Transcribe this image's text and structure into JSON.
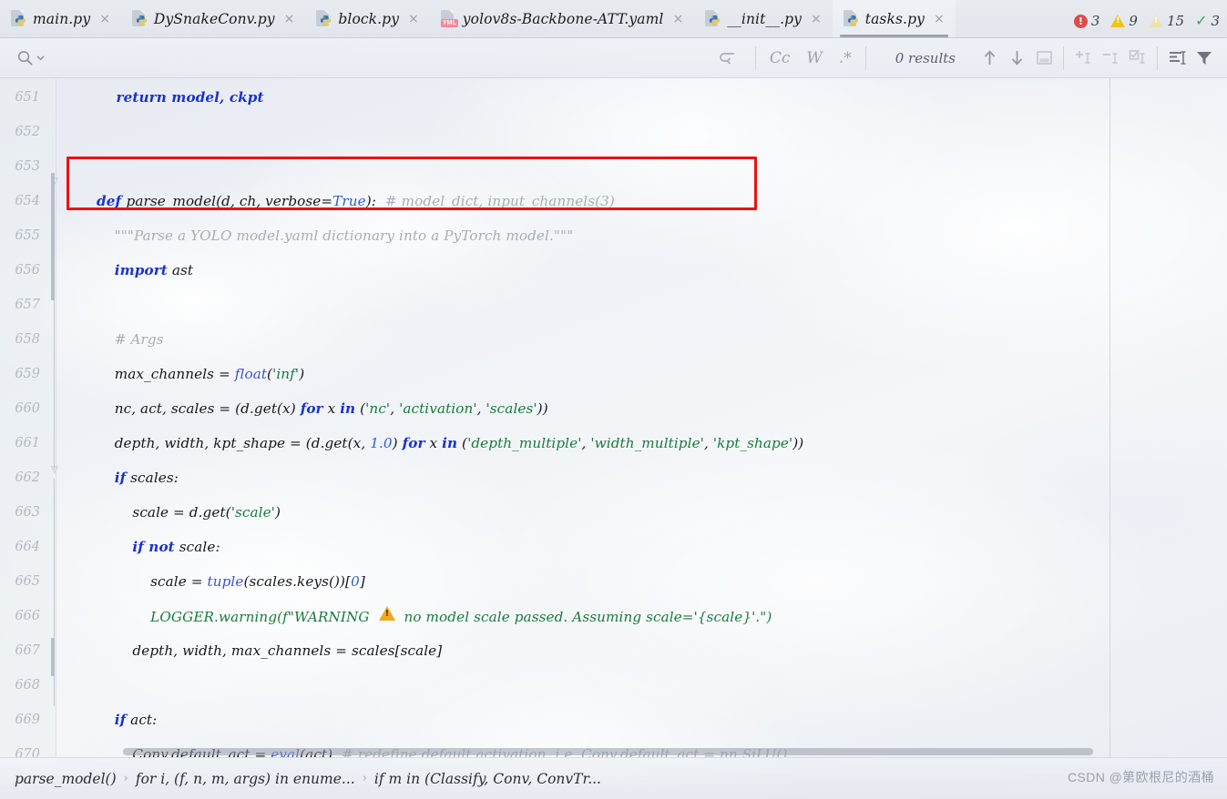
{
  "tabs": [
    {
      "label": "main.py",
      "icon": "python-file-icon",
      "active": false
    },
    {
      "label": "DySnakeConv.py",
      "icon": "python-file-icon",
      "active": false
    },
    {
      "label": "block.py",
      "icon": "python-file-icon",
      "active": false
    },
    {
      "label": "yolov8s-Backbone-ATT.yaml",
      "icon": "yaml-file-icon",
      "active": false
    },
    {
      "label": "__init__.py",
      "icon": "python-file-icon",
      "active": false
    },
    {
      "label": "tasks.py",
      "icon": "python-file-icon",
      "active": true
    }
  ],
  "findbar": {
    "search_value": "",
    "search_placeholder": "",
    "search_icon": "search-icon",
    "dropdown_icon": "chevron-down-icon",
    "multiline_icon": "multiline-toggle-icon",
    "match_case_label": "Cc",
    "words_label": "W",
    "regex_label": ".*",
    "results_label": "0 results",
    "prev_icon": "arrow-up-icon",
    "next_icon": "arrow-down-icon",
    "select_all_icon": "select-all-icon",
    "add_occurrence_icon": "add-occurrence-icon",
    "remove_occurrence_icon": "remove-occurrence-icon",
    "toggle_occurrence_icon": "toggle-occurrence-icon",
    "in_selection_icon": "search-in-selection-icon",
    "filter_icon": "filter-funnel-icon"
  },
  "inspections": {
    "error_count": "3",
    "warning_count": "9",
    "weak_warning_count": "15",
    "ok_count": "3",
    "error_color": "#e04a4a",
    "warning_color": "#f2c317",
    "weak_warning_color": "#eee2b4",
    "ok_color": "#37a846"
  },
  "editor": {
    "annotation_color": "#ee1111",
    "lines": [
      {
        "no": "651",
        "code": [
          {
            "t": "    return model, ckpt",
            "c": "kw-return"
          }
        ]
      },
      {
        "no": "652",
        "code": []
      },
      {
        "no": "653",
        "code": []
      },
      {
        "no": "654",
        "code": [
          {
            "t": "def ",
            "c": "kw"
          },
          {
            "t": "parse_model",
            "c": "fn"
          },
          {
            "t": "(d, ch, verbose=",
            "c": ""
          },
          {
            "t": "True",
            "c": "cnst"
          },
          {
            "t": "):  ",
            "c": ""
          },
          {
            "t": "# model_dict, input_channels(3)",
            "c": "cmt"
          }
        ]
      },
      {
        "no": "655",
        "code": [
          {
            "t": "    \"\"\"Parse a YOLO model.yaml dictionary into a PyTorch model.\"\"\"",
            "c": "doc"
          }
        ]
      },
      {
        "no": "656",
        "code": [
          {
            "t": "    ",
            "c": ""
          },
          {
            "t": "import",
            "c": "kw"
          },
          {
            "t": " ast",
            "c": ""
          }
        ]
      },
      {
        "no": "657",
        "code": []
      },
      {
        "no": "658",
        "code": [
          {
            "t": "    # Args",
            "c": "cmt"
          }
        ]
      },
      {
        "no": "659",
        "code": [
          {
            "t": "    max_channels = ",
            "c": ""
          },
          {
            "t": "float",
            "c": "bi"
          },
          {
            "t": "(",
            "c": ""
          },
          {
            "t": "'inf'",
            "c": "str"
          },
          {
            "t": ")",
            "c": ""
          }
        ]
      },
      {
        "no": "660",
        "code": [
          {
            "t": "    nc, act, scales = (d.get(x) ",
            "c": ""
          },
          {
            "t": "for",
            "c": "kw"
          },
          {
            "t": " x ",
            "c": ""
          },
          {
            "t": "in",
            "c": "kw"
          },
          {
            "t": " (",
            "c": ""
          },
          {
            "t": "'nc'",
            "c": "str"
          },
          {
            "t": ", ",
            "c": ""
          },
          {
            "t": "'activation'",
            "c": "str"
          },
          {
            "t": ", ",
            "c": ""
          },
          {
            "t": "'scales'",
            "c": "str"
          },
          {
            "t": "))",
            "c": ""
          }
        ]
      },
      {
        "no": "661",
        "code": [
          {
            "t": "    depth, width, kpt_shape = (d.get(x, ",
            "c": ""
          },
          {
            "t": "1.0",
            "c": "num"
          },
          {
            "t": ") ",
            "c": ""
          },
          {
            "t": "for",
            "c": "kw"
          },
          {
            "t": " x ",
            "c": ""
          },
          {
            "t": "in",
            "c": "kw"
          },
          {
            "t": " (",
            "c": ""
          },
          {
            "t": "'depth_multiple'",
            "c": "str"
          },
          {
            "t": ", ",
            "c": ""
          },
          {
            "t": "'width_multiple'",
            "c": "str"
          },
          {
            "t": ", ",
            "c": ""
          },
          {
            "t": "'kpt_shape'",
            "c": "str"
          },
          {
            "t": "))",
            "c": ""
          }
        ]
      },
      {
        "no": "662",
        "code": [
          {
            "t": "    ",
            "c": ""
          },
          {
            "t": "if",
            "c": "kw"
          },
          {
            "t": " scales:",
            "c": ""
          }
        ]
      },
      {
        "no": "663",
        "code": [
          {
            "t": "        scale = d.get(",
            "c": ""
          },
          {
            "t": "'scale'",
            "c": "str"
          },
          {
            "t": ")",
            "c": ""
          }
        ]
      },
      {
        "no": "664",
        "code": [
          {
            "t": "        ",
            "c": ""
          },
          {
            "t": "if not",
            "c": "kw"
          },
          {
            "t": " scale:",
            "c": ""
          }
        ]
      },
      {
        "no": "665",
        "code": [
          {
            "t": "            scale = ",
            "c": ""
          },
          {
            "t": "tuple",
            "c": "bi"
          },
          {
            "t": "(scales.keys())[",
            "c": ""
          },
          {
            "t": "0",
            "c": "num"
          },
          {
            "t": "]",
            "c": ""
          }
        ]
      },
      {
        "no": "666",
        "code": [
          {
            "t": "            LOGGER.warning(",
            "c": "str"
          },
          {
            "t": "f\"WARNING ",
            "c": "str"
          },
          {
            "t": "WARN_EMOJI",
            "c": "emoji"
          },
          {
            "t": " no model scale passed. Assuming scale='{scale}'.\")",
            "c": "str"
          }
        ]
      },
      {
        "no": "667",
        "code": [
          {
            "t": "        depth, width, max_channels = scales[scale]",
            "c": ""
          }
        ]
      },
      {
        "no": "668",
        "code": []
      },
      {
        "no": "669",
        "code": [
          {
            "t": "    ",
            "c": ""
          },
          {
            "t": "if",
            "c": "kw"
          },
          {
            "t": " act:",
            "c": ""
          }
        ]
      },
      {
        "no": "670",
        "code": [
          {
            "t": "        Conv.default_act = ",
            "c": ""
          },
          {
            "t": "eval",
            "c": "bi"
          },
          {
            "t": "(act)  ",
            "c": ""
          },
          {
            "t": "# redefine default activation, i.e. Conv.default_act = nn.SiLU()",
            "c": "cmt"
          }
        ]
      }
    ]
  },
  "breadcrumb": {
    "items": [
      "parse_model()",
      "for i, (f, n, m, args) in enume...",
      "if m in (Classify, Conv, ConvTr..."
    ],
    "separator": "›"
  },
  "watermark": {
    "text": "CSDN @第欧根尼的酒桶"
  }
}
